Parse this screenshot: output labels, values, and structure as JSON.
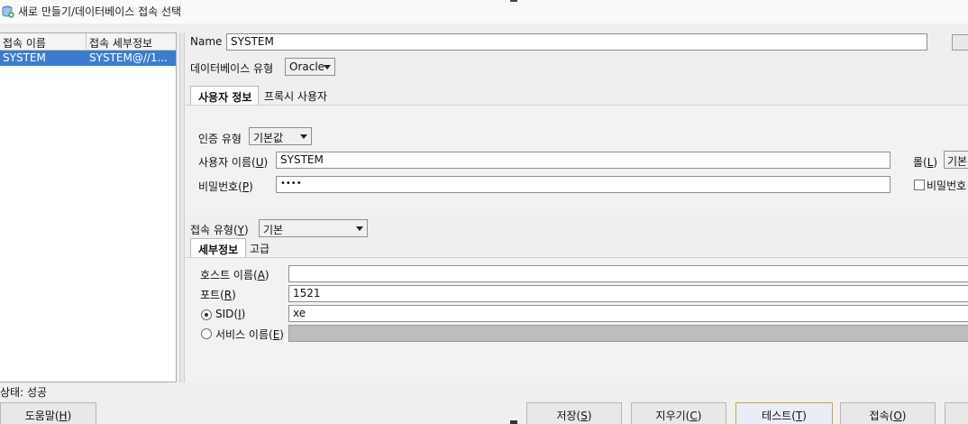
{
  "window": {
    "title": "새로 만들기/데이터베이스 접속 선택",
    "icon": "add-database-icon"
  },
  "conn_list": {
    "col_name": "접속 이름",
    "col_detail": "접속 세부정보",
    "rows": [
      {
        "name": "SYSTEM",
        "detail": "SYSTEM@//1..."
      }
    ]
  },
  "form": {
    "name_label": "Name",
    "name_value": "SYSTEM",
    "dbtype_label": "데이터베이스 유형",
    "dbtype_value": "Oracle",
    "tabs": [
      "사용자 정보",
      "프록시 사용자"
    ],
    "auth_label": "인증 유형",
    "auth_value": "기본값",
    "user_label": "사용자 이름(",
    "user_key": "U",
    "user_value": "SYSTEM",
    "pw_label": "비밀번호(",
    "pw_key": "P",
    "pw_value": "••••",
    "role_label": "롤(",
    "role_key": "L",
    "role_value": "기본",
    "save_pw_label": "비밀번호",
    "conn_type_label": "접속 유형(",
    "conn_type_key": "Y",
    "conn_type_value": "기본",
    "conn_tabs": [
      "세부정보",
      "고급"
    ],
    "host_label": "호스트 이름(",
    "host_key": "A",
    "host_value": "",
    "port_label": "포트(",
    "port_key": "R",
    "port_value": "1521",
    "sid_label": "SID(",
    "sid_key": "I",
    "sid_value": "xe",
    "service_label": "서비스 이름(",
    "service_key": "E",
    "service_value": ""
  },
  "status": "상태: 성공",
  "buttons": {
    "help": {
      "text": "도움말(",
      "key": "H"
    },
    "save": {
      "text": "저장(",
      "key": "S"
    },
    "clear": {
      "text": "지우기(",
      "key": "C"
    },
    "test": {
      "text": "테스트(",
      "key": "T"
    },
    "connect": {
      "text": "접속(",
      "key": "O"
    }
  },
  "colors": {
    "selection": "#3a7dd0",
    "default_button_border": "#c9a23a",
    "disabled_field": "#bdbdbd"
  }
}
